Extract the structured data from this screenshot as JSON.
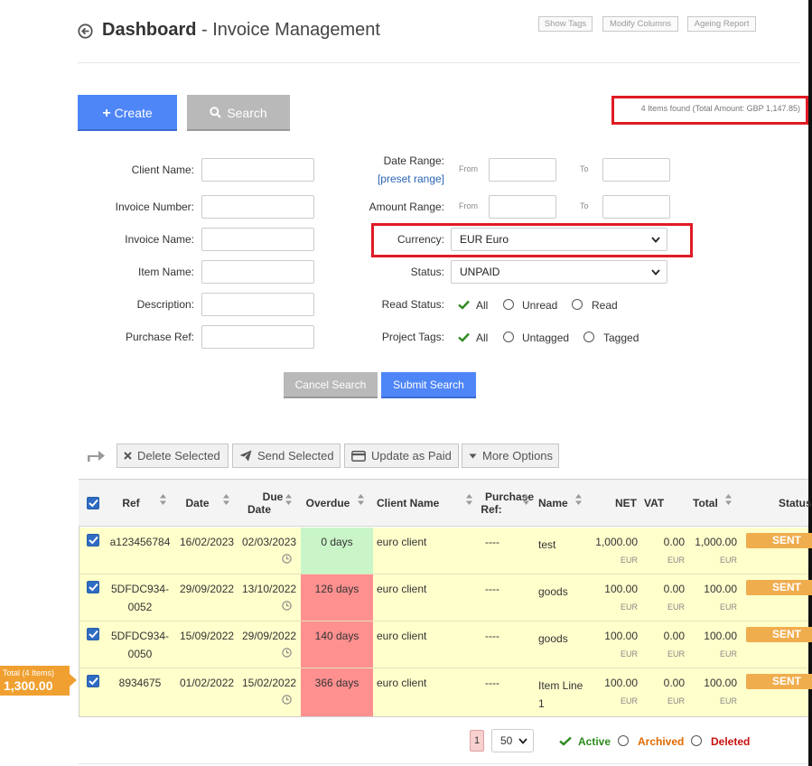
{
  "header": {
    "title_bold": "Dashboard",
    "title_rest": " - Invoice Management",
    "show_tags": "Show Tags",
    "modify_columns": "Modify Columns",
    "ageing_report": "Ageing Report"
  },
  "actions": {
    "create": "Create",
    "search": "Search",
    "found": "4 Items found (Total Amount: GBP 1,147.85)"
  },
  "form": {
    "client_name": "Client Name:",
    "invoice_number": "Invoice Number:",
    "invoice_name": "Invoice Name:",
    "item_name": "Item Name:",
    "description": "Description:",
    "purchase_ref": "Purchase Ref:",
    "date_range": "Date Range:",
    "preset_range": "[preset range]",
    "amount_range": "Amount Range:",
    "from": "From",
    "to": "To",
    "currency_label": "Currency:",
    "currency_value": "EUR Euro",
    "status_label": "Status:",
    "status_value": "UNPAID",
    "read_status": "Read Status:",
    "read_all": "All",
    "read_unread": "Unread",
    "read_read": "Read",
    "project_tags": "Project Tags:",
    "tags_all": "All",
    "tags_untagged": "Untagged",
    "tags_tagged": "Tagged",
    "cancel": "Cancel Search",
    "submit": "Submit Search"
  },
  "toolbar": {
    "delete": "Delete Selected",
    "send": "Send Selected",
    "update_paid": "Update as Paid",
    "more": "More Options"
  },
  "table": {
    "headers": {
      "ref": "Ref",
      "date": "Date",
      "due_1": "Due",
      "due_2": "Date",
      "overdue": "Overdue",
      "client": "Client Name",
      "purchase_1": "Purchase",
      "purchase_2": "Ref:",
      "name": "Name",
      "net": "NET",
      "vat": "VAT",
      "total": "Total",
      "status": "Status"
    },
    "currency_unit": "EUR",
    "rows": [
      {
        "ref1": "a123456784",
        "ref2": "",
        "date": "16/02/2023",
        "due": "02/03/2023",
        "overdue": "0 days",
        "client": "euro client",
        "pref": "----",
        "name1": "test",
        "name2": "",
        "net": "1,000.00",
        "vat": "0.00",
        "total": "1,000.00",
        "status": "SENT"
      },
      {
        "ref1": "5DFDC934-",
        "ref2": "0052",
        "date": "29/09/2022",
        "due": "13/10/2022",
        "overdue": "126 days",
        "client": "euro client",
        "pref": "----",
        "name1": "goods",
        "name2": "",
        "net": "100.00",
        "vat": "0.00",
        "total": "100.00",
        "status": "SENT"
      },
      {
        "ref1": "5DFDC934-",
        "ref2": "0050",
        "date": "15/09/2022",
        "due": "29/09/2022",
        "overdue": "140 days",
        "client": "euro client",
        "pref": "----",
        "name1": "goods",
        "name2": "",
        "net": "100.00",
        "vat": "0.00",
        "total": "100.00",
        "status": "SENT"
      },
      {
        "ref1": "8934675",
        "ref2": "",
        "date": "01/02/2022",
        "due": "15/02/2022",
        "overdue": "366 days",
        "client": "euro client",
        "pref": "----",
        "name1": "Item Line",
        "name2": "1",
        "net": "100.00",
        "vat": "0.00",
        "total": "100.00",
        "status": "SENT"
      }
    ],
    "total_label": "Total (4 Items)",
    "total_value": "1,300.00"
  },
  "footer": {
    "page": "1",
    "per_page": "50",
    "active": "Active",
    "archived": "Archived",
    "deleted": "Deleted"
  },
  "colors": {
    "primary": "#4f86f7",
    "highlight_red": "#e01b24",
    "sent": "#f0ad4e",
    "overdue_red": "#ff9090",
    "overdue_green": "#c9f5c9",
    "row_yellow": "#ffffcc",
    "active_green": "#2d8a1e",
    "archived_orange": "#e06a00",
    "deleted_red": "#c81010"
  }
}
